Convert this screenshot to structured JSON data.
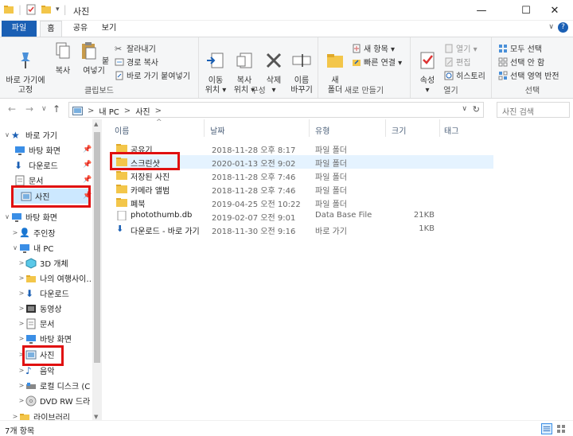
{
  "window": {
    "title": "사진",
    "minimize": "—",
    "maximize": "☐",
    "close": "✕"
  },
  "ribbon_tabs": [
    "파일",
    "홈",
    "공유",
    "보기"
  ],
  "ribbon": {
    "clipboard": {
      "pin_label": "바로 가기에\n고정",
      "copy_label": "복사",
      "paste_label": "붙여넣기",
      "cut_label": "잘라내기",
      "copy_path_label": "경로 복사",
      "paste_shortcut_label": "바로 가기 붙여넣기",
      "group_label": "클립보드"
    },
    "organize": {
      "move_label": "이동\n위치 ▾",
      "copy_to_label": "복사\n위치 ▾",
      "delete_label": "삭제\n▾",
      "rename_label": "이름\n바꾸기",
      "group_label": "구성"
    },
    "new": {
      "new_folder_label": "새\n폴더",
      "new_item_label": "새 항목 ▾",
      "easy_access_label": "빠른 연결 ▾",
      "group_label": "새로 만들기"
    },
    "open": {
      "properties_label": "속성\n▾",
      "open_label": "열기 ▾",
      "edit_label": "편집",
      "history_label": "히스토리",
      "group_label": "열기"
    },
    "select": {
      "select_all_label": "모두 선택",
      "select_none_label": "선택 안 함",
      "invert_label": "선택 영역 반전",
      "group_label": "선택"
    }
  },
  "address": {
    "back": "←",
    "forward": "→",
    "recent": "∨",
    "up": "↑",
    "crumb_sep": ">",
    "crumbs": [
      "내 PC",
      "사진"
    ],
    "search_placeholder": "사진 검색"
  },
  "nav": {
    "items": [
      {
        "label": "바로 가기",
        "icon": "star-icon"
      },
      {
        "label": "바탕 화면",
        "icon": "desktop-icon"
      },
      {
        "label": "다운로드",
        "icon": "download-icon"
      },
      {
        "label": "문서",
        "icon": "document-icon"
      },
      {
        "label": "사진",
        "icon": "pictures-icon"
      },
      {
        "label": "바탕 화면",
        "icon": "desktop-icon"
      },
      {
        "label": "주인장",
        "icon": "user-icon"
      },
      {
        "label": "내 PC",
        "icon": "computer-icon"
      },
      {
        "label": "3D 개체",
        "icon": "3d-objects-icon"
      },
      {
        "label": "나의 여행사이…",
        "icon": "folder-icon"
      },
      {
        "label": "다운로드",
        "icon": "download-icon"
      },
      {
        "label": "동영상",
        "icon": "video-icon"
      },
      {
        "label": "문서",
        "icon": "document-icon"
      },
      {
        "label": "바탕 화면",
        "icon": "desktop-icon"
      },
      {
        "label": "사진",
        "icon": "pictures-icon"
      },
      {
        "label": "음악",
        "icon": "music-icon"
      },
      {
        "label": "로컬 디스크 (C",
        "icon": "disk-icon"
      },
      {
        "label": "DVD RW 드라",
        "icon": "dvd-icon"
      },
      {
        "label": "라이브러리",
        "icon": "library-icon"
      }
    ]
  },
  "columns": {
    "name": "이름",
    "date": "날짜",
    "type": "유형",
    "size": "크기",
    "tags": "태그"
  },
  "files": [
    {
      "name": "공유기",
      "date": "2018-11-28 오후 8:17",
      "type": "파일 폴더",
      "size": ""
    },
    {
      "name": "스크린샷",
      "date": "2020-01-13 오전 9:02",
      "type": "파일 폴더",
      "size": ""
    },
    {
      "name": "저장된 사진",
      "date": "2018-11-28 오후 7:46",
      "type": "파일 폴더",
      "size": ""
    },
    {
      "name": "카메라 앨범",
      "date": "2018-11-28 오후 7:46",
      "type": "파일 폴더",
      "size": ""
    },
    {
      "name": "폐북",
      "date": "2019-04-25 오전 10:22",
      "type": "파일 폴더",
      "size": ""
    },
    {
      "name": "photothumb.db",
      "date": "2019-02-07 오전 9:01",
      "type": "Data Base File",
      "size": "21KB"
    },
    {
      "name": "다운로드 - 바로 가기",
      "date": "2018-11-30 오전 9:16",
      "type": "바로 가기",
      "size": "1KB"
    }
  ],
  "status": {
    "count": "7개 항목"
  },
  "colors": {
    "accent": "#1a5fb4",
    "selected": "#cce8ff",
    "hover": "#e5f3ff",
    "highlight": "#e01010",
    "folder": "#f3c64a"
  }
}
